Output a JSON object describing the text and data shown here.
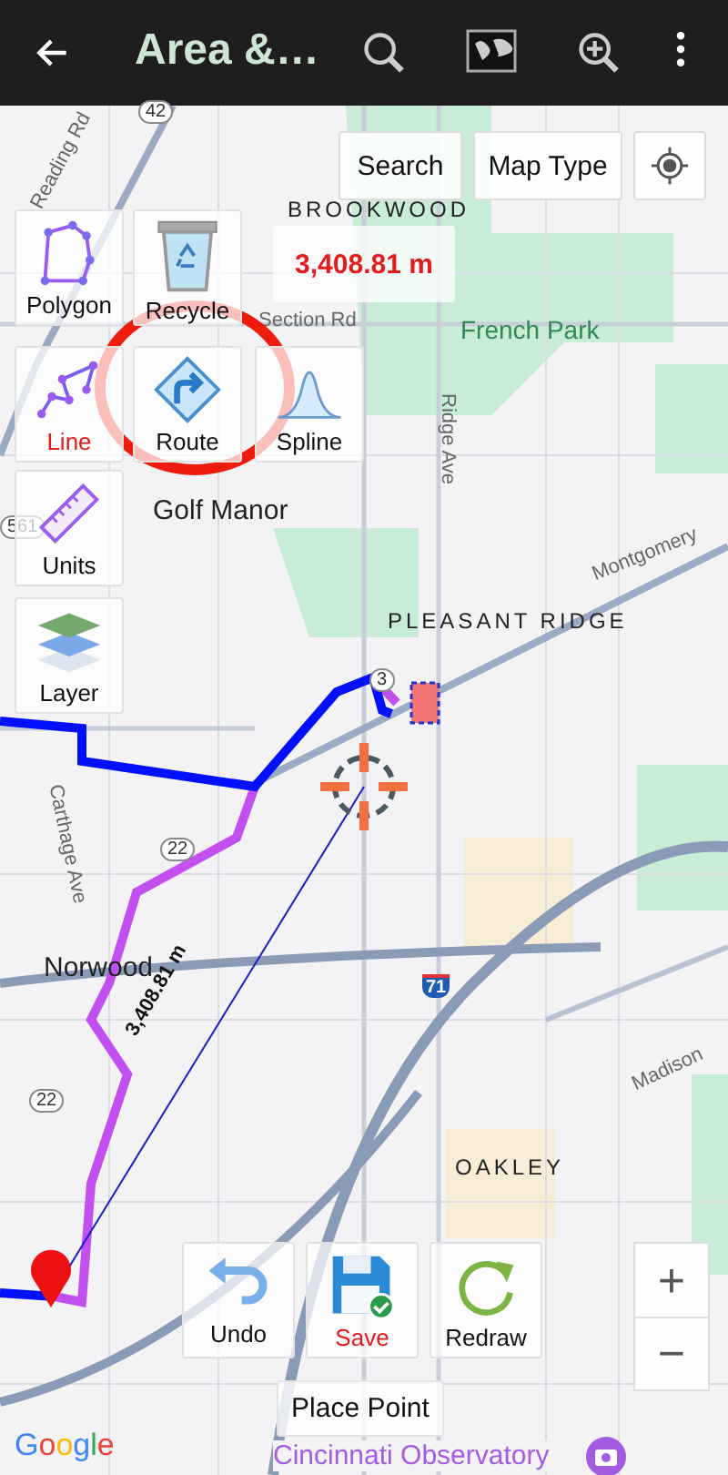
{
  "app_bar": {
    "title": "Area &…"
  },
  "top_buttons": [
    {
      "label": "Search"
    },
    {
      "label": "Map Type"
    }
  ],
  "measurement": "3,408.81 m",
  "tools": [
    {
      "label": "Polygon",
      "kind": "polygon",
      "selected": false
    },
    {
      "label": "Recycle",
      "kind": "recycle",
      "selected": false
    },
    {
      "label": "Line",
      "kind": "line",
      "selected": true
    },
    {
      "label": "Route",
      "kind": "route",
      "selected": false
    },
    {
      "label": "Spline",
      "kind": "spline",
      "selected": false
    },
    {
      "label": "Units",
      "kind": "units",
      "selected": false
    },
    {
      "label": "Layer",
      "kind": "layer",
      "selected": false
    }
  ],
  "actions": [
    {
      "label": "Undo",
      "kind": "undo",
      "highlighted": false
    },
    {
      "label": "Save",
      "kind": "save",
      "highlighted": true
    },
    {
      "label": "Redraw",
      "kind": "redraw",
      "highlighted": false
    }
  ],
  "place_point": "Place Point",
  "zoom": {
    "in": "+",
    "out": "−"
  },
  "map": {
    "labels": [
      {
        "text": "42",
        "kind": "shield"
      },
      {
        "text": "Reading Rd",
        "kind": "road"
      },
      {
        "text": "BROOKWOOD",
        "kind": "area"
      },
      {
        "text": "Section Rd",
        "kind": "road"
      },
      {
        "text": "French Park",
        "kind": "park"
      },
      {
        "text": "Ridge Ave",
        "kind": "road"
      },
      {
        "text": "Golf Manor",
        "kind": "place"
      },
      {
        "text": "Montgomery",
        "kind": "road"
      },
      {
        "text": "561",
        "kind": "shield"
      },
      {
        "text": "PLEASANT RIDGE",
        "kind": "area"
      },
      {
        "text": "3",
        "kind": "shield"
      },
      {
        "text": "Carthage Ave",
        "kind": "road"
      },
      {
        "text": "22",
        "kind": "shield"
      },
      {
        "text": "Norwood",
        "kind": "place"
      },
      {
        "text": "71",
        "kind": "interstate"
      },
      {
        "text": "22",
        "kind": "shield"
      },
      {
        "text": "Madison",
        "kind": "road"
      },
      {
        "text": "OAKLEY",
        "kind": "area"
      },
      {
        "text": "3,408.81 m",
        "kind": "measure"
      }
    ],
    "attribution": "Google",
    "poi": "Cincinnati Observatory"
  }
}
